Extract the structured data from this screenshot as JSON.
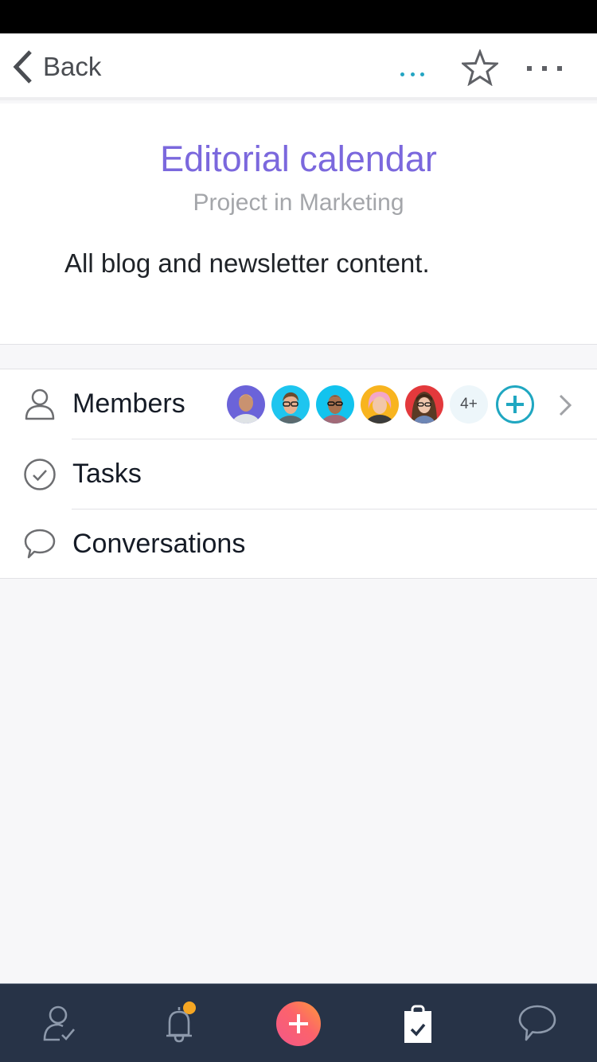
{
  "nav": {
    "back_label": "Back",
    "icons": [
      "chevron-left-icon",
      "loading-dots-icon",
      "star-icon",
      "more-options-icon"
    ]
  },
  "project": {
    "title": "Editorial calendar",
    "subtitle": "Project in Marketing",
    "description": "All blog and newsletter content.",
    "title_color": "#7b68dd"
  },
  "list": {
    "rows": [
      {
        "label": "Members",
        "icon": "person-icon"
      },
      {
        "label": "Tasks",
        "icon": "check-circle-icon"
      },
      {
        "label": "Conversations",
        "icon": "speech-bubble-icon"
      }
    ],
    "members": {
      "avatar_backgrounds": [
        "#6b63d9",
        "#1ec5ef",
        "#12c3ee",
        "#f8b41f",
        "#e3393c"
      ],
      "more_count": "4+",
      "accent_color": "#20a7c1"
    }
  },
  "tabbar": {
    "tabs": [
      {
        "name": "my-tasks",
        "icon": "person-check-icon",
        "active": false
      },
      {
        "name": "inbox",
        "icon": "bell-icon",
        "active": false,
        "has_badge": true
      },
      {
        "name": "create",
        "icon": "plus-icon",
        "active": false
      },
      {
        "name": "projects",
        "icon": "clipboard-check-icon",
        "active": true
      },
      {
        "name": "conversations",
        "icon": "speech-bubble-icon",
        "active": false
      }
    ],
    "badge_color": "#f5a623",
    "background": "#273347"
  }
}
